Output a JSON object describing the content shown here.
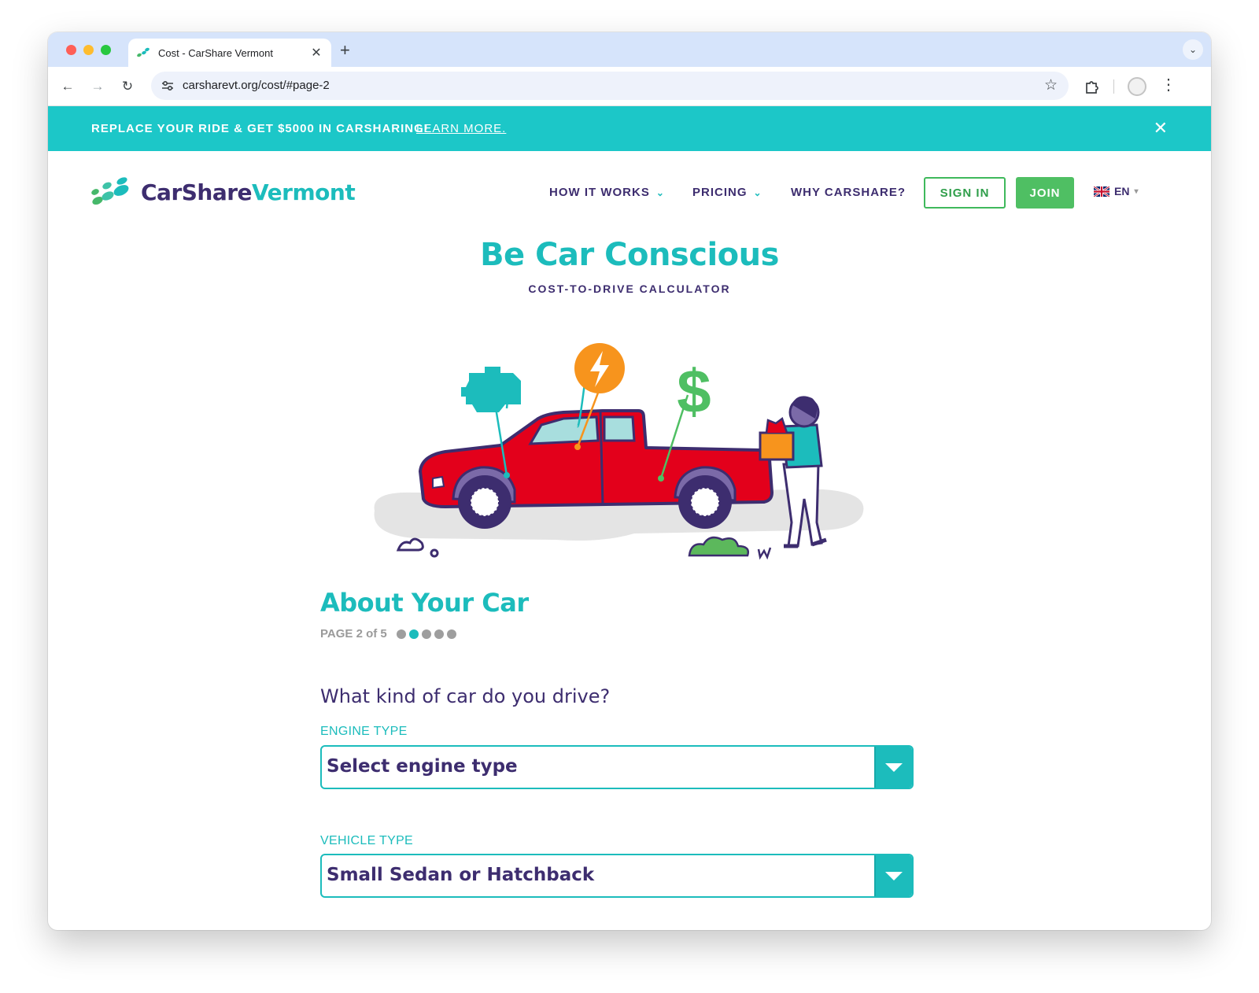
{
  "browser": {
    "tab_title": "Cost - CarShare Vermont",
    "tab_close": "✕",
    "new_tab": "+",
    "url": "carsharevt.org/cost/#page-2",
    "back": "←",
    "forward": "→",
    "reload": "↻",
    "star": "☆",
    "menu": "⋮",
    "tab_menu": "⌄"
  },
  "banner": {
    "text": "REPLACE YOUR RIDE & GET $5000 IN CARSHARING!",
    "link": "LEARN MORE.",
    "close": "✕"
  },
  "logo": {
    "part1": "CarShare",
    "part2": "Vermont"
  },
  "nav": {
    "how_it_works": "HOW IT WORKS",
    "pricing": "PRICING",
    "why": "WHY CARSHARE?",
    "caret": "⌄"
  },
  "auth": {
    "sign_in": "SIGN IN",
    "join": "JOIN"
  },
  "lang": {
    "code": "EN",
    "caret": "▾"
  },
  "hero": {
    "title": "Be Car Conscious",
    "subtitle": "COST-TO-DRIVE CALCULATOR"
  },
  "section": {
    "title": "About Your Car",
    "page_indicator": "PAGE 2 of 5",
    "current_page": 2,
    "total_pages": 5
  },
  "form": {
    "question": "What kind of car do you drive?",
    "engine_label": "ENGINE TYPE",
    "engine_value": "Select engine type",
    "vehicle_label": "VEHICLE TYPE",
    "vehicle_value": "Small Sedan or Hatchback"
  },
  "colors": {
    "teal": "#1cbcbc",
    "purple": "#3d2d6f",
    "green": "#4fbf63",
    "truck_red": "#e3001b",
    "orange": "#f7941d"
  },
  "icons": [
    "engine-icon",
    "lightning-icon",
    "dollar-icon",
    "flag-icon",
    "star-icon",
    "extension-icon"
  ]
}
